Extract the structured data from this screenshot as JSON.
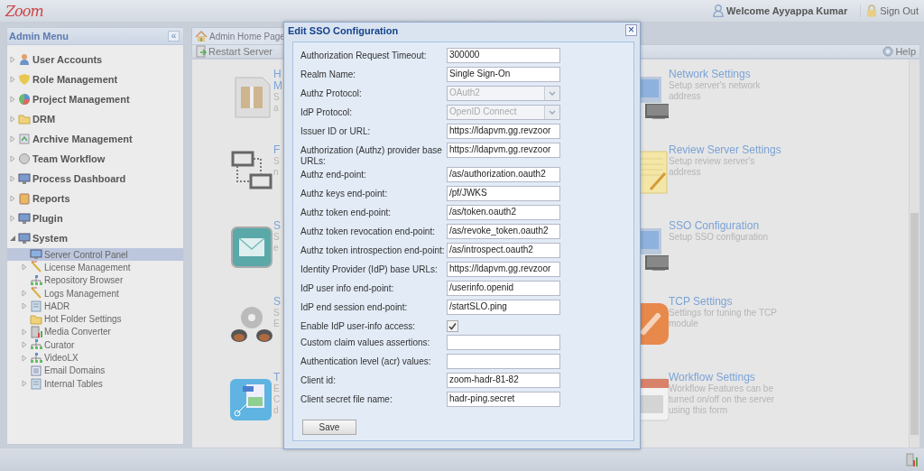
{
  "header": {
    "logo": "Zoom",
    "welcome": "Welcome Ayyappa Kumar",
    "sign_out": "Sign Out"
  },
  "sidebar": {
    "title": "Admin Menu",
    "collapse": "«",
    "items": [
      {
        "label": "User Accounts",
        "kind": "branch",
        "expanded": false,
        "selected": false
      },
      {
        "label": "Role Management",
        "kind": "branch",
        "expanded": false,
        "selected": false
      },
      {
        "label": "Project Management",
        "kind": "branch",
        "expanded": false,
        "selected": false
      },
      {
        "label": "DRM",
        "kind": "branch",
        "expanded": false,
        "selected": false
      },
      {
        "label": "Archive Management",
        "kind": "branch",
        "expanded": false,
        "selected": false
      },
      {
        "label": "Team Workflow",
        "kind": "branch",
        "expanded": false,
        "selected": false
      },
      {
        "label": "Process Dashboard",
        "kind": "branch",
        "expanded": false,
        "selected": false
      },
      {
        "label": "Reports",
        "kind": "branch",
        "expanded": false,
        "selected": false
      },
      {
        "label": "Plugin",
        "kind": "branch",
        "expanded": false,
        "selected": false
      },
      {
        "label": "System",
        "kind": "branch",
        "expanded": true,
        "selected": false,
        "children": [
          {
            "label": "Server Control Panel",
            "kind": "leaf",
            "selected": true
          },
          {
            "label": "License Management",
            "kind": "branch",
            "expanded": false,
            "selected": false
          },
          {
            "label": "Repository Browser",
            "kind": "leaf",
            "selected": false
          },
          {
            "label": "Logs Management",
            "kind": "branch",
            "expanded": false,
            "selected": false
          },
          {
            "label": "HADR",
            "kind": "branch",
            "expanded": false,
            "selected": false
          },
          {
            "label": "Hot Folder Settings",
            "kind": "leaf",
            "selected": false
          },
          {
            "label": "Media Converter",
            "kind": "branch",
            "expanded": false,
            "selected": false
          },
          {
            "label": "Curator",
            "kind": "branch",
            "expanded": false,
            "selected": false
          },
          {
            "label": "VideoLX",
            "kind": "branch",
            "expanded": false,
            "selected": false
          },
          {
            "label": "Email Domains",
            "kind": "leaf",
            "selected": false
          },
          {
            "label": "Internal Tables",
            "kind": "branch",
            "expanded": false,
            "selected": false
          }
        ]
      }
    ]
  },
  "tabs": [
    {
      "label": "Admin Home Page",
      "selected": false
    }
  ],
  "toolbar": {
    "restart": "Restart Server",
    "help": "Help"
  },
  "cards": [
    {
      "title_lines": [
        "H",
        "M"
      ],
      "description_lines": [
        "S",
        "a"
      ]
    },
    {
      "title_lines": [
        "Network Settings"
      ],
      "description_lines": [
        "Setup server's network",
        "address"
      ]
    },
    {
      "title_lines": [
        "F"
      ],
      "description_lines": [
        "S",
        "n"
      ]
    },
    {
      "title_lines": [
        "Review Server Settings"
      ],
      "description_lines": [
        "Setup review server's",
        "address"
      ]
    },
    {
      "title_lines": [
        "S"
      ],
      "description_lines": [
        "S",
        "e"
      ]
    },
    {
      "title_lines": [
        "SSO Configuration"
      ],
      "description_lines": [
        "Setup SSO configuration"
      ]
    },
    {
      "title_lines": [
        "S"
      ],
      "description_lines": [
        "S",
        "E"
      ]
    },
    {
      "title_lines": [
        "TCP Settings"
      ],
      "description_lines": [
        "Settings for tuning the TCP",
        "module"
      ]
    },
    {
      "title_lines": [
        "T"
      ],
      "description_lines": [
        "E",
        "C",
        "d"
      ]
    },
    {
      "title_lines": [
        "Workflow Settings"
      ],
      "description_lines": [
        "Workflow Features can be",
        "turned on/off on the server",
        "using this form"
      ]
    }
  ],
  "dialog": {
    "title": "Edit SSO Configuration",
    "close": "×",
    "save": "Save",
    "fields": [
      {
        "label": "Authorization Request Timeout:",
        "kind": "text",
        "value": "300000"
      },
      {
        "label": "Realm Name:",
        "kind": "text",
        "value": "Single Sign-On"
      },
      {
        "label": "Authz Protocol:",
        "kind": "select",
        "value": "OAuth2",
        "disabled": true
      },
      {
        "label": "IdP Protocol:",
        "kind": "select",
        "value": "OpenID Connect",
        "disabled": true
      },
      {
        "label": "Issuer ID or URL:",
        "kind": "text",
        "value": "https://ldapvm.gg.revzoor"
      },
      {
        "label": "Authorization (Authz) provider base URLs:",
        "kind": "text",
        "value": "https://ldapvm.gg.revzoor"
      },
      {
        "label": "Authz end-point:",
        "kind": "text",
        "value": "/as/authorization.oauth2"
      },
      {
        "label": "Authz keys end-point:",
        "kind": "text",
        "value": "/pf/JWKS"
      },
      {
        "label": "Authz token end-point:",
        "kind": "text",
        "value": "/as/token.oauth2"
      },
      {
        "label": "Authz token revocation end-point:",
        "kind": "text",
        "value": "/as/revoke_token.oauth2"
      },
      {
        "label": "Authz token introspection end-point:",
        "kind": "text",
        "value": "/as/introspect.oauth2"
      },
      {
        "label": "Identity Provider (IdP) base URLs:",
        "kind": "text",
        "value": "https://ldapvm.gg.revzoor"
      },
      {
        "label": "IdP user info end-point:",
        "kind": "text",
        "value": "/userinfo.openid"
      },
      {
        "label": "IdP end session end-point:",
        "kind": "text",
        "value": "/startSLO.ping"
      },
      {
        "label": "Enable IdP user-info access:",
        "kind": "checkbox",
        "checked": true
      },
      {
        "label": "Custom claim values assertions:",
        "kind": "text"
      },
      {
        "label": "Authentication level (acr) values:",
        "kind": "text"
      },
      {
        "label": "Client id:",
        "kind": "text",
        "value": "zoom-hadr-81-82"
      },
      {
        "label": "Client secret file name:",
        "kind": "text",
        "value": "hadr-ping.secret"
      }
    ]
  }
}
